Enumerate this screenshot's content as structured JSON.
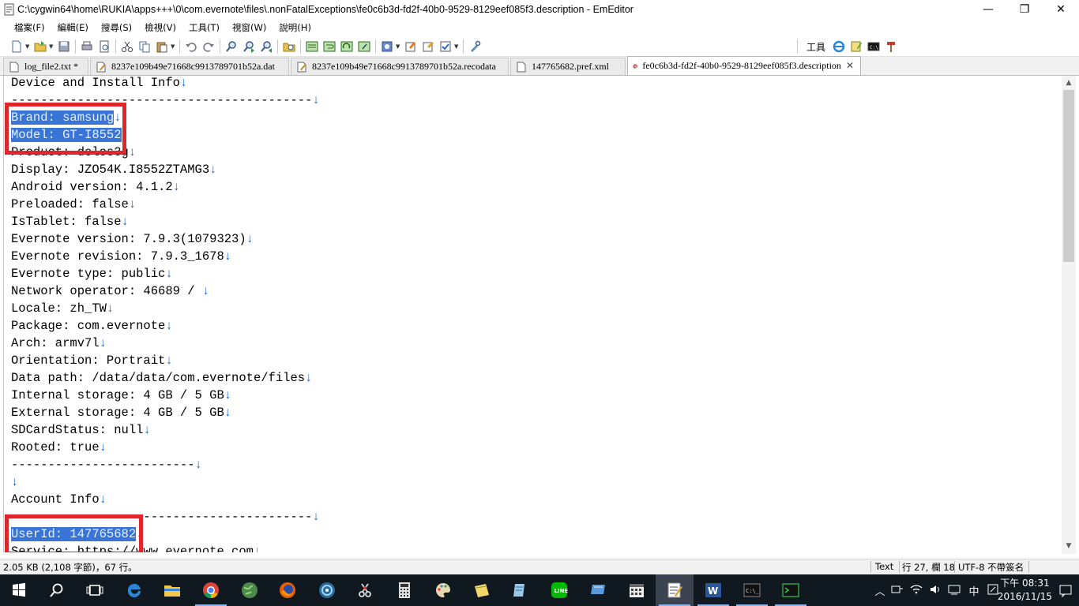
{
  "window": {
    "title": "C:\\cygwin64\\home\\RUKIA\\apps+++\\0\\com.evernote\\files\\.nonFatalExceptions\\fe0c6b3d-fd2f-40b0-9529-8129eef085f3.description - EmEditor",
    "minimize": "—",
    "maximize": "❐",
    "close": "✕"
  },
  "menu": [
    "檔案(F)",
    "編輯(E)",
    "搜尋(S)",
    "檢視(V)",
    "工具(T)",
    "視窗(W)",
    "說明(H)"
  ],
  "toolbar": {
    "tools_label": "工具"
  },
  "tabs": [
    {
      "label": "log_file2.txt *",
      "icon": "text-file-icon"
    },
    {
      "label": "8237e109b49e71668c9913789701b52a.dat",
      "icon": "edit-file-icon"
    },
    {
      "label": "8237e109b49e71668c9913789701b52a.recodata",
      "icon": "edit-file-icon"
    },
    {
      "label": "147765682.pref.xml",
      "icon": "text-file-icon"
    },
    {
      "label": "fe0c6b3d-fd2f-40b0-9529-8129eef085f3.description",
      "icon": "chrome-icon",
      "active": true
    }
  ],
  "tab_close": "✕",
  "editor": {
    "lines": [
      {
        "text": "Device and Install Info",
        "eol": "↓"
      },
      {
        "text": "-----------------------------------------",
        "eol": "↓"
      },
      {
        "text": "Brand: samsung",
        "eol": "↓",
        "selected": true
      },
      {
        "text": "Model: GT-I8552",
        "eol": "↓",
        "selected": true
      },
      {
        "text": "Product: delos3g",
        "eol": "↓",
        "obscured": true
      },
      {
        "text": "Display: JZO54K.I8552ZTAMG3",
        "eol": "↓"
      },
      {
        "text": "Android version: 4.1.2",
        "eol": "↓"
      },
      {
        "text": "Preloaded: false",
        "eol": "↓"
      },
      {
        "text": "IsTablet: false",
        "eol": "↓"
      },
      {
        "text": "Evernote version: 7.9.3(1079323)",
        "eol": "↓"
      },
      {
        "text": "Evernote revision: 7.9.3_1678",
        "eol": "↓"
      },
      {
        "text": "Evernote type: public",
        "eol": "↓"
      },
      {
        "text": "Network operator: 46689 / ",
        "eol": "↓"
      },
      {
        "text": "Locale: zh_TW",
        "eol": "↓"
      },
      {
        "text": "Package: com.evernote",
        "eol": "↓"
      },
      {
        "text": "Arch: armv7l",
        "eol": "↓"
      },
      {
        "text": "Orientation: Portrait",
        "eol": "↓"
      },
      {
        "text": "Data path: /data/data/com.evernote/files",
        "eol": "↓"
      },
      {
        "text": "Internal storage: 4 GB / 5 GB",
        "eol": "↓"
      },
      {
        "text": "External storage: 4 GB / 5 GB",
        "eol": "↓"
      },
      {
        "text": "SDCardStatus: null",
        "eol": "↓"
      },
      {
        "text": "Rooted: true",
        "eol": "↓"
      },
      {
        "text": "-------------------------",
        "eol": "↓"
      },
      {
        "text": "",
        "eol": "↓"
      },
      {
        "text": "Account Info",
        "eol": "↓"
      },
      {
        "text": "-----------------------------------------",
        "eol": "↓"
      },
      {
        "text": "UserId: 147765682",
        "eol": "↓",
        "selected": true
      },
      {
        "text": "Service: https://www.evernote.com",
        "eol": "↓"
      }
    ]
  },
  "status": {
    "left": "2.05 KB (2,108 字節)，67 行。",
    "mode": "Text",
    "position": "行 27, 欄 18",
    "encoding": "UTF-8 不帶簽名"
  },
  "taskbar": {
    "clock_time": "下午 08:31",
    "clock_date": "2016/11/15",
    "ime": "中"
  },
  "colors": {
    "selection": "#3875d6",
    "eol_marker": "#1a66cc",
    "highlight_box": "#e0262a",
    "taskbar": "#101820"
  }
}
